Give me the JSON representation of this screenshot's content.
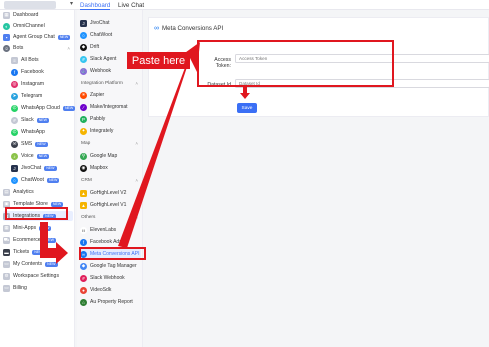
{
  "topbar": {
    "tabs": [
      "Dashboard",
      "Live Chat"
    ]
  },
  "sidebar": {
    "items": [
      {
        "label": "Dashboard",
        "icon": "grid-icon",
        "color": "#b5b9c6"
      },
      {
        "label": "OmniChannel",
        "icon": "omnichannel-icon",
        "color": "#26c6a2"
      },
      {
        "label": "Agent Group Chat",
        "icon": "chat-icon",
        "color": "#4f7ff0",
        "badge": "NEW"
      },
      {
        "label": "Bots",
        "icon": "bot-icon",
        "color": "#6b7280"
      },
      {
        "label": "All Bots",
        "icon": "list-icon",
        "color": "#b5b9c6"
      },
      {
        "label": "Facebook",
        "icon": "facebook-icon",
        "color": "#1877f2"
      },
      {
        "label": "Instagram",
        "icon": "instagram-icon",
        "color": "#e1306c"
      },
      {
        "label": "Telegram",
        "icon": "telegram-icon",
        "color": "#2aa3df"
      },
      {
        "label": "WhatsApp Cloud",
        "icon": "whatsapp-icon",
        "color": "#25d366",
        "badge": "NEW"
      },
      {
        "label": "Slack",
        "icon": "slack-icon",
        "color": "#b5b9c6",
        "badge": "NEW"
      },
      {
        "label": "WhatsApp",
        "icon": "whatsapp-icon",
        "color": "#25d366"
      },
      {
        "label": "SMS",
        "icon": "sms-icon",
        "color": "#3a3f4b",
        "badge": "NEW"
      },
      {
        "label": "Voice",
        "icon": "voice-icon",
        "color": "#8bc34a",
        "badge": "NEW"
      },
      {
        "label": "JivoChat",
        "icon": "jivochat-icon",
        "color": "#26324d",
        "badge": "NEW"
      },
      {
        "label": "ChatWoot",
        "icon": "chatwoot-icon",
        "color": "#1f93ff",
        "badge": "NEW"
      },
      {
        "label": "Analytics",
        "icon": "analytics-icon",
        "color": "#b5b9c6"
      },
      {
        "label": "Template Store",
        "icon": "store-icon",
        "color": "#b5b9c6",
        "badge": "NEW"
      },
      {
        "label": "Integrations",
        "icon": "integrations-icon",
        "color": "#b5b9c6",
        "badge": "NEW"
      },
      {
        "label": "Mini-Apps",
        "icon": "mini-apps-icon",
        "color": "#b5b9c6",
        "badge": "NEW"
      },
      {
        "label": "Ecommerce",
        "icon": "ecommerce-icon",
        "color": "#b5b9c6",
        "badge": "NEW"
      },
      {
        "label": "Tickets",
        "icon": "tickets-icon",
        "color": "#3a3f4b",
        "badge": "NEW"
      },
      {
        "label": "My Contents",
        "icon": "contents-icon",
        "color": "#b5b9c6",
        "badge": "NEW"
      },
      {
        "label": "Workspace Settings",
        "icon": "settings-icon",
        "color": "#b5b9c6"
      },
      {
        "label": "Billing",
        "icon": "billing-icon",
        "color": "#b5b9c6"
      }
    ]
  },
  "subpanel": {
    "items_top": [
      {
        "label": "JivoChat",
        "color": "#26324d"
      },
      {
        "label": "ChatWoot",
        "color": "#1f93ff"
      },
      {
        "label": "Drift",
        "color": "#111"
      },
      {
        "label": "Slack Agent",
        "color": "#36c5f0"
      },
      {
        "label": "Webhook",
        "color": "#8a6bd8"
      }
    ],
    "section_integration": "Integration Platform",
    "items_integration": [
      {
        "label": "Zapier",
        "color": "#ff4a00"
      },
      {
        "label": "Make/Integromat",
        "color": "#6d00cc"
      },
      {
        "label": "Pabbly",
        "color": "#20b05c"
      },
      {
        "label": "Integrately",
        "color": "#f5b400"
      }
    ],
    "section_map": "Map",
    "items_map": [
      {
        "label": "Google Map",
        "color": "#34a853"
      },
      {
        "label": "Mapbox",
        "color": "#111"
      }
    ],
    "section_crm": "CRM",
    "items_crm": [
      {
        "label": "GoHighLevel V2",
        "color": "#f5b400"
      },
      {
        "label": "GoHighLevel V1",
        "color": "#f5b400"
      }
    ],
    "section_others": "Others",
    "items_others": [
      {
        "label": "ElevenLabs",
        "color": "#111"
      },
      {
        "label": "Facebook Ads",
        "color": "#1877f2"
      },
      {
        "label": "Meta Conversions API",
        "color": "#1877f2"
      },
      {
        "label": "Google Tag Manager",
        "color": "#4285f4"
      },
      {
        "label": "Slack Webhook",
        "color": "#e01e5a"
      },
      {
        "label": "VideoSdk",
        "color": "#ea4335"
      },
      {
        "label": "Au Property Report",
        "color": "#2e7d32"
      }
    ]
  },
  "main": {
    "title": "Meta Conversions API",
    "access_token_label": "Access Token:",
    "access_token_placeholder": "Access Token",
    "dataset_label": "Dataset Id",
    "dataset_placeholder": "Dataset Id",
    "save_label": "Save"
  },
  "annotation": {
    "paste_label": "Paste here",
    "color": "#e0171f"
  }
}
